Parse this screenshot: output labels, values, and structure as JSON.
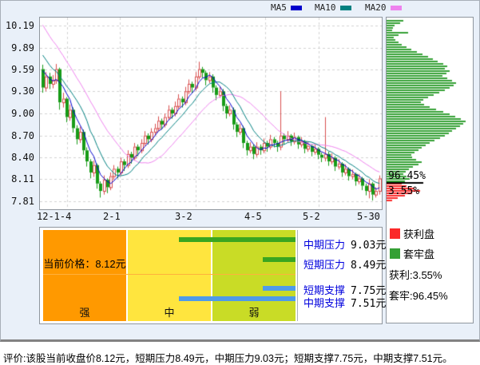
{
  "legend_top": {
    "ma5_label": "MA5",
    "ma10_label": "MA10",
    "ma20_label": "MA20"
  },
  "colors": {
    "ma5": "#0000cc",
    "ma10": "#008080",
    "ma20": "#ee82ee",
    "candle_up": "#d94f4f",
    "candle_down": "#179b17",
    "profile_green": "#35a035",
    "profile_red": "#fb2929",
    "zone_strong": "#ff9900",
    "zone_medium": "#ffe53e",
    "zone_weak": "#c9dc26",
    "bar_pressure": "#3aa520",
    "bar_support": "#4f9be8",
    "label_blue": "#0000dd",
    "widget_bg": "#e9f0f9"
  },
  "chart_data": [
    {
      "type": "candlestick",
      "title": "",
      "y_ticks": [
        "10.19",
        "9.89",
        "9.59",
        "9.30",
        "9.00",
        "8.70",
        "8.40",
        "8.11",
        "7.81"
      ],
      "y_range": [
        7.81,
        10.19
      ],
      "x_ticks": [
        "12-1-4",
        "2-1",
        "3-2",
        "4-5",
        "5-2",
        "5-30"
      ],
      "grid": true,
      "legend": [
        "MA5",
        "MA10",
        "MA20"
      ],
      "prior_closes": [
        11.0,
        10.9,
        10.8,
        10.72,
        10.64,
        10.56,
        10.48,
        10.4,
        10.32,
        10.24,
        10.16,
        10.08,
        10.0,
        9.92,
        9.84,
        9.76,
        9.68,
        9.6,
        9.5
      ],
      "candles": [
        [
          9.6,
          9.66,
          9.28,
          9.35
        ],
        [
          9.35,
          9.56,
          9.3,
          9.5
        ],
        [
          9.5,
          9.55,
          9.33,
          9.4
        ],
        [
          9.4,
          9.52,
          9.34,
          9.45
        ],
        [
          9.45,
          9.67,
          9.4,
          9.6
        ],
        [
          9.6,
          9.62,
          9.05,
          9.15
        ],
        [
          9.15,
          9.28,
          9.08,
          9.2
        ],
        [
          9.2,
          9.22,
          8.88,
          8.95
        ],
        [
          8.95,
          9.12,
          8.9,
          9.05
        ],
        [
          9.05,
          9.08,
          8.74,
          8.8
        ],
        [
          8.8,
          8.84,
          8.58,
          8.65
        ],
        [
          8.65,
          8.82,
          8.6,
          8.75
        ],
        [
          8.75,
          8.78,
          8.44,
          8.5
        ],
        [
          8.5,
          8.54,
          8.28,
          8.35
        ],
        [
          8.35,
          8.38,
          8.12,
          8.2
        ],
        [
          8.2,
          8.36,
          8.14,
          8.3
        ],
        [
          8.3,
          8.32,
          7.98,
          8.05
        ],
        [
          8.05,
          8.08,
          7.86,
          7.95
        ],
        [
          7.95,
          8.16,
          7.9,
          8.1
        ],
        [
          8.1,
          8.12,
          7.92,
          8.0
        ],
        [
          8.0,
          8.2,
          7.96,
          8.15
        ],
        [
          8.15,
          8.3,
          8.1,
          8.25
        ],
        [
          8.25,
          8.28,
          8.12,
          8.2
        ],
        [
          8.2,
          8.4,
          8.16,
          8.35
        ],
        [
          8.35,
          8.38,
          8.22,
          8.3
        ],
        [
          8.3,
          8.5,
          8.26,
          8.45
        ],
        [
          8.45,
          8.48,
          8.32,
          8.4
        ],
        [
          8.4,
          8.6,
          8.36,
          8.55
        ],
        [
          8.55,
          8.58,
          8.42,
          8.5
        ],
        [
          8.5,
          8.65,
          8.46,
          8.6
        ],
        [
          8.6,
          8.76,
          8.56,
          8.7
        ],
        [
          8.7,
          8.73,
          8.58,
          8.65
        ],
        [
          8.65,
          8.8,
          8.61,
          8.75
        ],
        [
          8.75,
          8.86,
          8.7,
          8.8
        ],
        [
          8.8,
          8.96,
          8.76,
          8.9
        ],
        [
          8.9,
          8.93,
          8.78,
          8.85
        ],
        [
          8.85,
          9.0,
          8.81,
          8.95
        ],
        [
          8.95,
          9.11,
          8.91,
          9.05
        ],
        [
          9.05,
          9.08,
          8.93,
          9.0
        ],
        [
          9.0,
          9.16,
          8.96,
          9.1
        ],
        [
          9.1,
          9.26,
          9.06,
          9.2
        ],
        [
          9.2,
          9.23,
          9.08,
          9.15
        ],
        [
          9.15,
          9.36,
          9.11,
          9.3
        ],
        [
          9.3,
          9.46,
          9.26,
          9.4
        ],
        [
          9.4,
          9.43,
          9.28,
          9.35
        ],
        [
          9.35,
          9.56,
          9.31,
          9.5
        ],
        [
          9.5,
          9.7,
          9.46,
          9.6
        ],
        [
          9.6,
          9.63,
          9.48,
          9.55
        ],
        [
          9.55,
          9.58,
          9.38,
          9.45
        ],
        [
          9.45,
          9.56,
          9.41,
          9.5
        ],
        [
          9.5,
          9.53,
          9.28,
          9.35
        ],
        [
          9.35,
          9.38,
          9.18,
          9.25
        ],
        [
          9.25,
          9.36,
          9.21,
          9.3
        ],
        [
          9.3,
          9.33,
          9.03,
          9.1
        ],
        [
          9.1,
          9.13,
          8.93,
          9.0
        ],
        [
          9.0,
          9.11,
          8.96,
          9.05
        ],
        [
          9.05,
          9.08,
          8.78,
          8.85
        ],
        [
          8.85,
          8.88,
          8.68,
          8.75
        ],
        [
          8.75,
          8.86,
          8.71,
          8.8
        ],
        [
          8.8,
          8.83,
          8.53,
          8.6
        ],
        [
          8.6,
          8.63,
          8.43,
          8.5
        ],
        [
          8.5,
          8.61,
          8.46,
          8.55
        ],
        [
          8.55,
          8.58,
          8.38,
          8.45
        ],
        [
          8.45,
          8.61,
          8.41,
          8.55
        ],
        [
          8.55,
          8.58,
          8.44,
          8.5
        ],
        [
          8.5,
          8.66,
          8.46,
          8.6
        ],
        [
          8.6,
          8.63,
          8.48,
          8.55
        ],
        [
          8.55,
          8.71,
          8.51,
          8.65
        ],
        [
          8.65,
          8.68,
          8.54,
          8.6
        ],
        [
          8.6,
          8.63,
          8.48,
          8.55
        ],
        [
          8.55,
          9.3,
          8.5,
          8.7
        ],
        [
          8.7,
          8.73,
          8.58,
          8.65
        ],
        [
          8.65,
          8.76,
          8.61,
          8.7
        ],
        [
          8.7,
          8.72,
          8.56,
          8.62
        ],
        [
          8.62,
          8.74,
          8.58,
          8.68
        ],
        [
          8.68,
          8.7,
          8.52,
          8.58
        ],
        [
          8.58,
          8.68,
          8.54,
          8.62
        ],
        [
          8.62,
          8.64,
          8.46,
          8.52
        ],
        [
          8.52,
          8.62,
          8.48,
          8.56
        ],
        [
          8.56,
          8.58,
          8.42,
          8.48
        ],
        [
          8.48,
          8.58,
          8.44,
          8.52
        ],
        [
          8.52,
          8.54,
          8.38,
          8.44
        ],
        [
          8.44,
          8.47,
          8.34,
          8.4
        ],
        [
          8.4,
          8.95,
          8.35,
          8.45
        ],
        [
          8.45,
          8.48,
          8.29,
          8.35
        ],
        [
          8.35,
          8.46,
          8.31,
          8.4
        ],
        [
          8.4,
          8.42,
          8.22,
          8.28
        ],
        [
          8.28,
          8.38,
          8.24,
          8.32
        ],
        [
          8.32,
          8.34,
          8.14,
          8.2
        ],
        [
          8.2,
          8.31,
          8.16,
          8.25
        ],
        [
          8.25,
          8.27,
          8.09,
          8.15
        ],
        [
          8.15,
          8.24,
          8.11,
          8.18
        ],
        [
          8.18,
          8.2,
          8.02,
          8.08
        ],
        [
          8.08,
          8.18,
          8.04,
          8.12
        ],
        [
          8.12,
          8.14,
          7.96,
          8.02
        ],
        [
          8.02,
          8.05,
          7.89,
          7.95
        ],
        [
          7.95,
          8.11,
          7.85,
          8.05
        ],
        [
          8.05,
          8.07,
          7.82,
          7.9
        ],
        [
          7.9,
          8.0,
          7.86,
          7.95
        ],
        [
          7.95,
          8.16,
          7.9,
          8.12
        ]
      ]
    },
    {
      "type": "bar",
      "title": "chip-distribution-profile",
      "orientation": "horizontal",
      "green_widths_pct": [
        20,
        16,
        10,
        8,
        7,
        26,
        14,
        9,
        11,
        14,
        18,
        24,
        30,
        37,
        43,
        50,
        56,
        62,
        68,
        73,
        70,
        76,
        72,
        67,
        73,
        79,
        84,
        81,
        76,
        70,
        63,
        57,
        50,
        44,
        41,
        45,
        52,
        60,
        68,
        76,
        83,
        89,
        95,
        92,
        88,
        84,
        79,
        75,
        70,
        64,
        58,
        52,
        47,
        42,
        38,
        34,
        30,
        31,
        36,
        42,
        38,
        32,
        27,
        23,
        20,
        24,
        28,
        22
      ],
      "red_widths_pct": [
        18,
        24,
        34,
        40,
        31,
        22,
        13,
        7
      ],
      "trapped_pct_label": "96.45%",
      "profit_pct_label": "3.55%"
    }
  ],
  "side_legend": {
    "profit_label": "获利盘",
    "trapped_label": "套牢盘",
    "profit_line": "获利:3.55%",
    "trapped_line": "套牢:96.45%"
  },
  "panel": {
    "current_price": "当前价格：8.12元",
    "zone_strong": "强",
    "zone_medium": "中",
    "zone_weak": "弱",
    "rows": [
      {
        "label": "中期压力",
        "value": "9.03元"
      },
      {
        "label": "短期压力",
        "value": "8.49元"
      },
      {
        "label": "短期支撑",
        "value": "7.75元"
      },
      {
        "label": "中期支撑",
        "value": "7.51元"
      }
    ]
  },
  "evaluation": "评价:该股当前收盘价8.12元，短期压力8.49元，中期压力9.03元；短期支撑7.75元，中期支撑7.51元。"
}
